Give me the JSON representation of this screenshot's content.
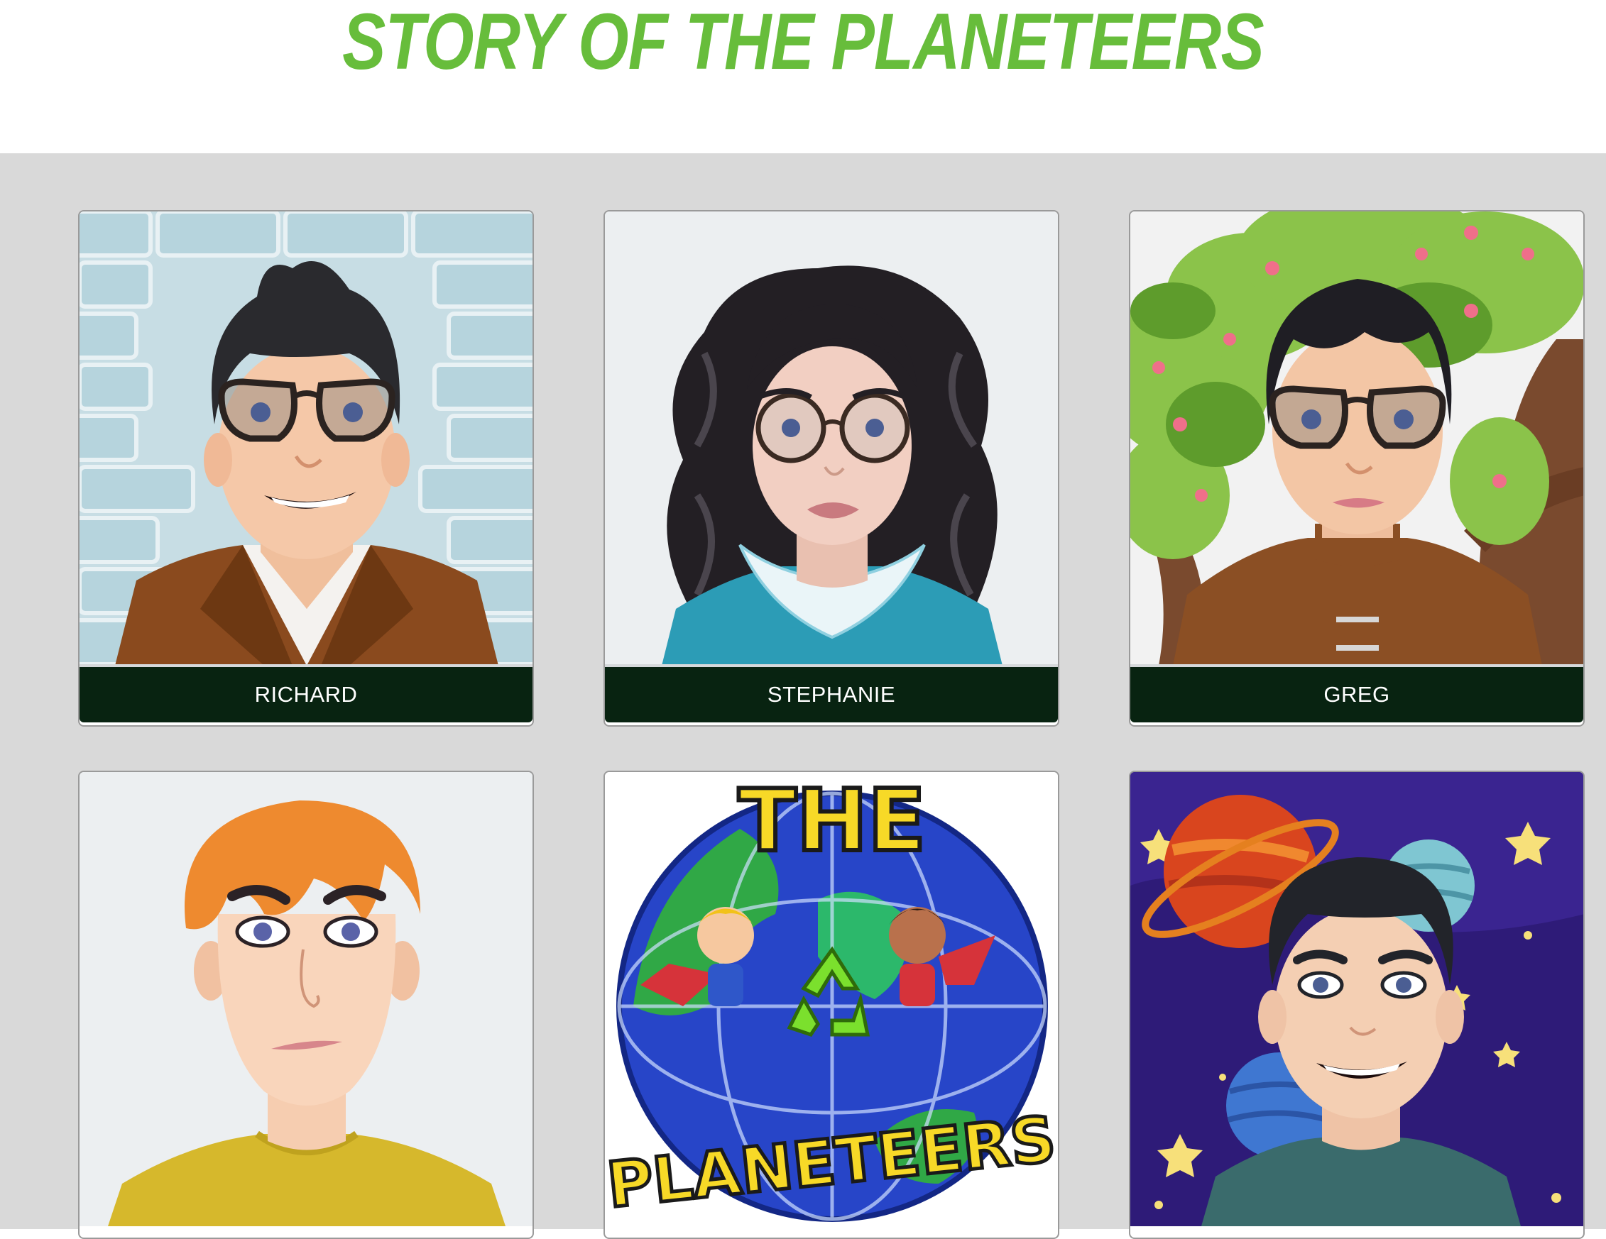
{
  "page": {
    "title": "STORY OF THE PLANETEERS"
  },
  "colors": {
    "title_green": "#67bd3b",
    "gallery_background": "#d9d9d9",
    "name_bar": "#082311"
  },
  "characters": [
    {
      "name": "RICHARD",
      "icon": "avatar-man-glasses-brick-wall"
    },
    {
      "name": "STEPHANIE",
      "icon": "avatar-woman-curly-hair-glasses"
    },
    {
      "name": "GREG",
      "icon": "avatar-man-glasses-tree"
    },
    {
      "name": "",
      "icon": "avatar-man-orange-hair"
    },
    {
      "name": "",
      "icon": "the-planeteers-logo"
    },
    {
      "name": "",
      "icon": "avatar-man-space-planets"
    }
  ],
  "logo": {
    "text_top": "THE",
    "text_bottom": "PLANETEERS"
  }
}
